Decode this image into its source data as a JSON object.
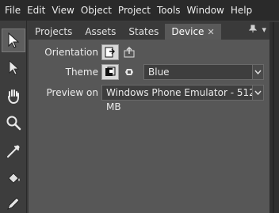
{
  "menubar": {
    "items": [
      "File",
      "Edit",
      "View",
      "Object",
      "Project",
      "Tools",
      "Window",
      "Help"
    ]
  },
  "toolbar": {
    "tools": [
      "selection-tool-icon",
      "direct-selection-tool-icon",
      "pan-hand-icon",
      "zoom-magnifier-icon",
      "eyedropper-icon",
      "paint-bucket-icon",
      "pencil-icon"
    ],
    "active": "selection-tool-icon"
  },
  "panel": {
    "tabs": [
      {
        "label": "Projects"
      },
      {
        "label": "Assets"
      },
      {
        "label": "States"
      },
      {
        "label": "Device",
        "close": "✕"
      }
    ],
    "active_tab": "Device",
    "pin_glyph": "📌",
    "menu_glyph": "▾"
  },
  "device": {
    "orientation_label": "Orientation",
    "theme_label": "Theme",
    "preview_label": "Preview on",
    "theme_accent": "Blue",
    "preview_target": "Windows Phone Emulator - 512 MB"
  },
  "colors": {
    "menubar_bg": "#2a2a2a",
    "panel_bg": "#575757",
    "tab_active_bg": "#595959"
  }
}
